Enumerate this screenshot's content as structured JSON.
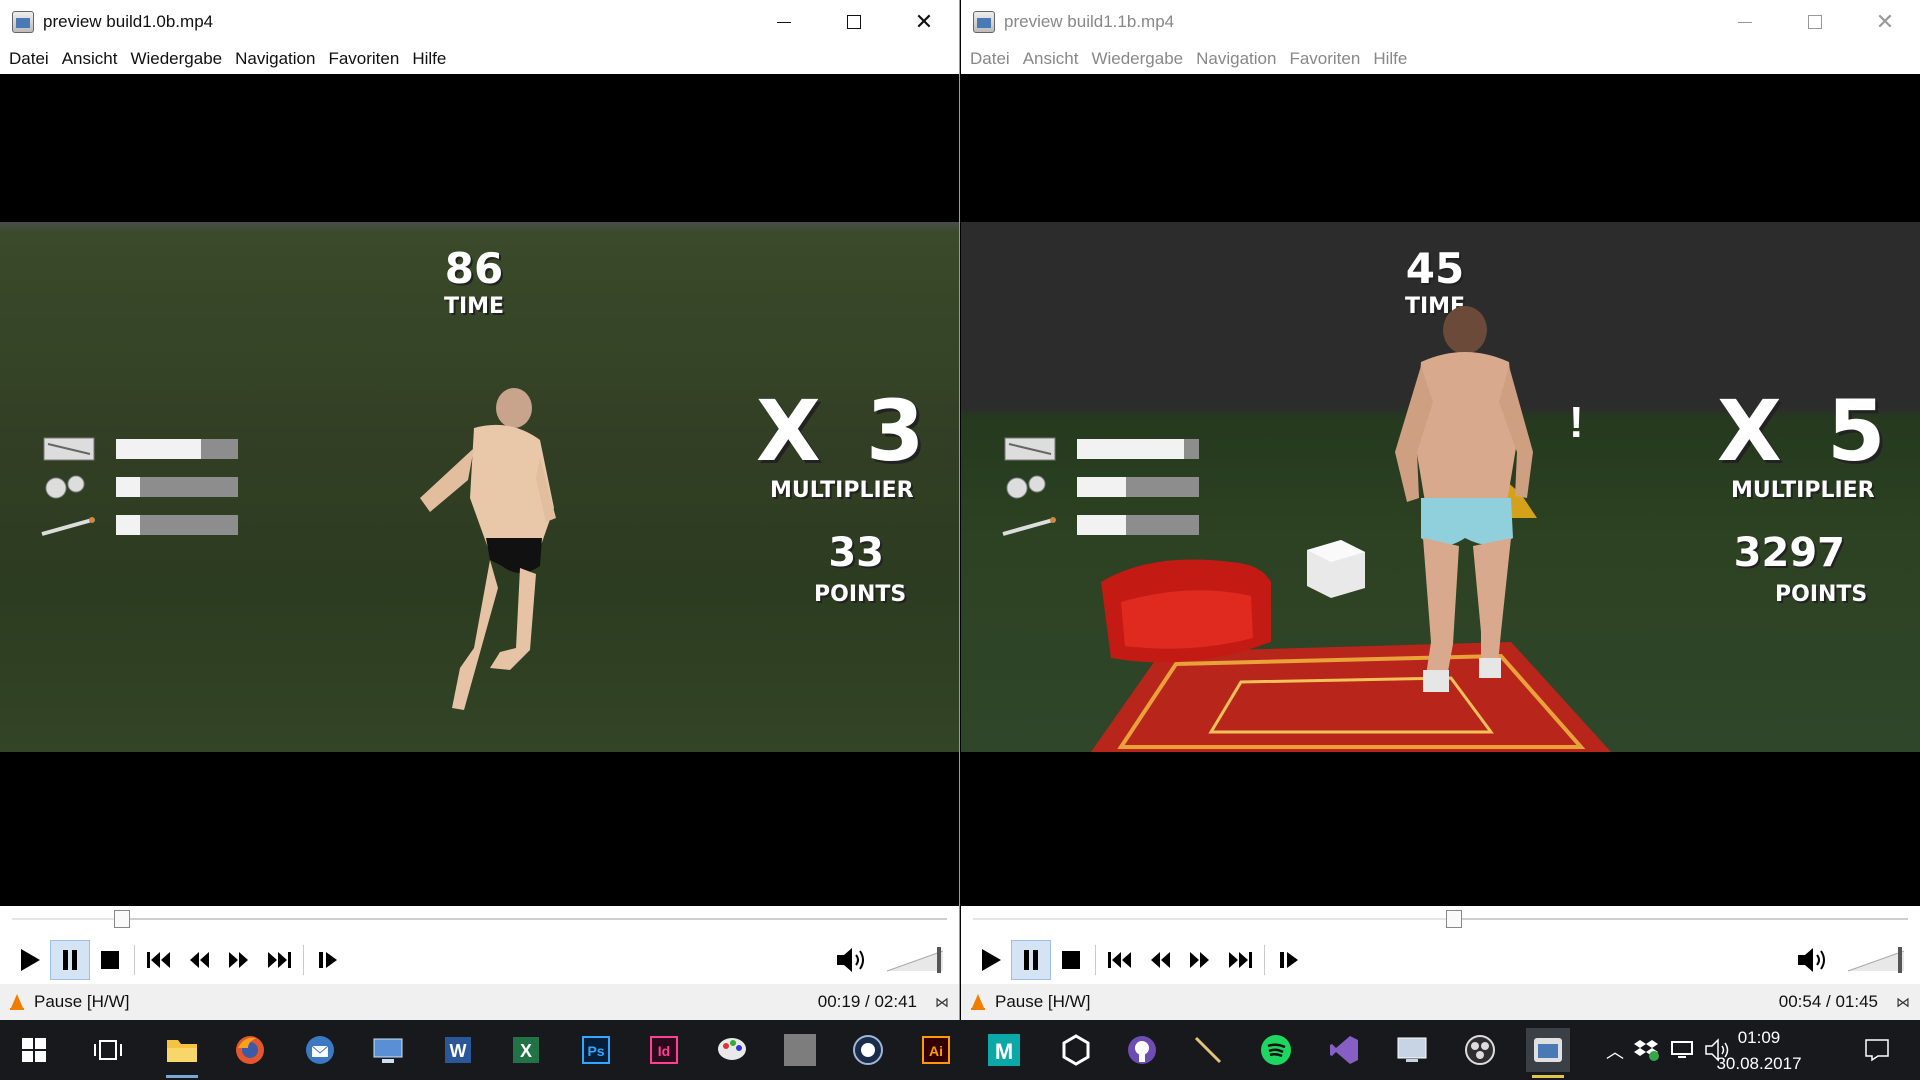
{
  "left": {
    "title": "preview build1.0b.mp4",
    "menu": [
      "Datei",
      "Ansicht",
      "Wiedergabe",
      "Navigation",
      "Favoriten",
      "Hilfe"
    ],
    "hud": {
      "time_value": "86",
      "time_label": "TIME",
      "multiplier": "X 3",
      "multiplier_label": "MULTIPLIER",
      "points": "33",
      "points_label": "POINTS"
    },
    "bars": [
      0.7,
      0.2,
      0.2
    ],
    "seek_progress": 0.118,
    "status": "Pause [H/W]",
    "time": "00:19 / 02:41"
  },
  "right": {
    "title": "preview build1.1b.mp4",
    "menu": [
      "Datei",
      "Ansicht",
      "Wiedergabe",
      "Navigation",
      "Favoriten",
      "Hilfe"
    ],
    "hud": {
      "time_value": "45",
      "time_label": "TIME",
      "multiplier": "X 5",
      "multiplier_label": "MULTIPLIER",
      "points": "3297",
      "points_label": "POINTS"
    },
    "bars": [
      0.88,
      0.4,
      0.4
    ],
    "seek_progress": 0.514,
    "status": "Pause [H/W]",
    "time": "00:54 / 01:45"
  },
  "taskbar": {
    "apps": [
      "windows-start",
      "task-view",
      "file-explorer",
      "firefox",
      "thunderbird",
      "network-app",
      "word",
      "excel",
      "photoshop",
      "indesign",
      "paint-app",
      "gray-app",
      "cinema4d",
      "illustrator",
      "maya",
      "unity",
      "github",
      "pen-tool",
      "spotify",
      "visual-studio",
      "monitor-app",
      "obs",
      "media-player-classic"
    ],
    "time": "01:09",
    "date": "30.08.2017"
  },
  "colors": {
    "accent_blue": "#d5e4f5",
    "taskbar_bg": "#17191d",
    "vlc_orange": "#f07d00"
  }
}
